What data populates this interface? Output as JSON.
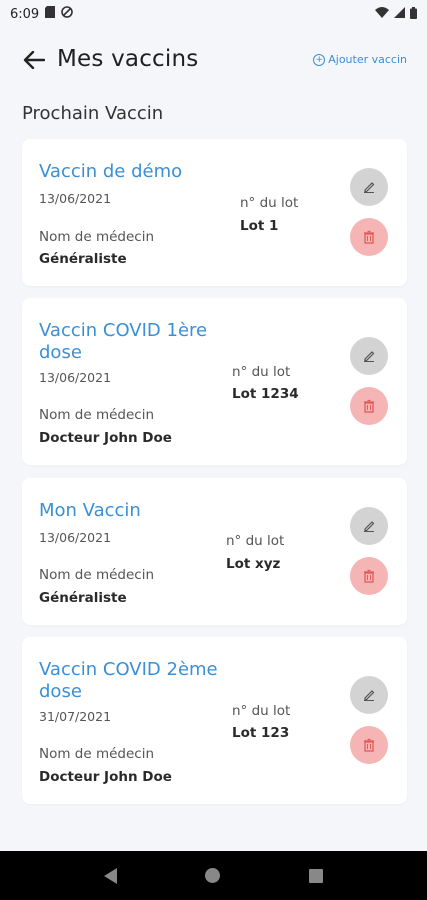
{
  "status": {
    "time": "6:09"
  },
  "header": {
    "title": "Mes vaccins",
    "add_label": "Ajouter vaccin"
  },
  "section_title": "Prochain Vaccin",
  "cards": [
    {
      "name": "Vaccin de démo",
      "date": "13/06/2021",
      "doctor_label": "Nom de médecin",
      "doctor": "Généraliste",
      "lot_label": "n° du lot",
      "lot": "Lot 1"
    },
    {
      "name": "Vaccin COVID 1ère dose",
      "date": "13/06/2021",
      "doctor_label": "Nom de médecin",
      "doctor": "Docteur John Doe",
      "lot_label": "n° du lot",
      "lot": "Lot 1234"
    },
    {
      "name": "Mon Vaccin",
      "date": "13/06/2021",
      "doctor_label": "Nom de médecin",
      "doctor": "Généraliste",
      "lot_label": "n° du lot",
      "lot": "Lot xyz"
    },
    {
      "name": "Vaccin COVID 2ème dose",
      "date": "31/07/2021",
      "doctor_label": "Nom de médecin",
      "doctor": "Docteur John Doe",
      "lot_label": "n° du lot",
      "lot": "Lot 123"
    }
  ],
  "colors": {
    "accent": "#3a8fd6",
    "edit": "#d3d3d3",
    "delete": "#f5b5b5",
    "background": "#f5f6fa"
  }
}
